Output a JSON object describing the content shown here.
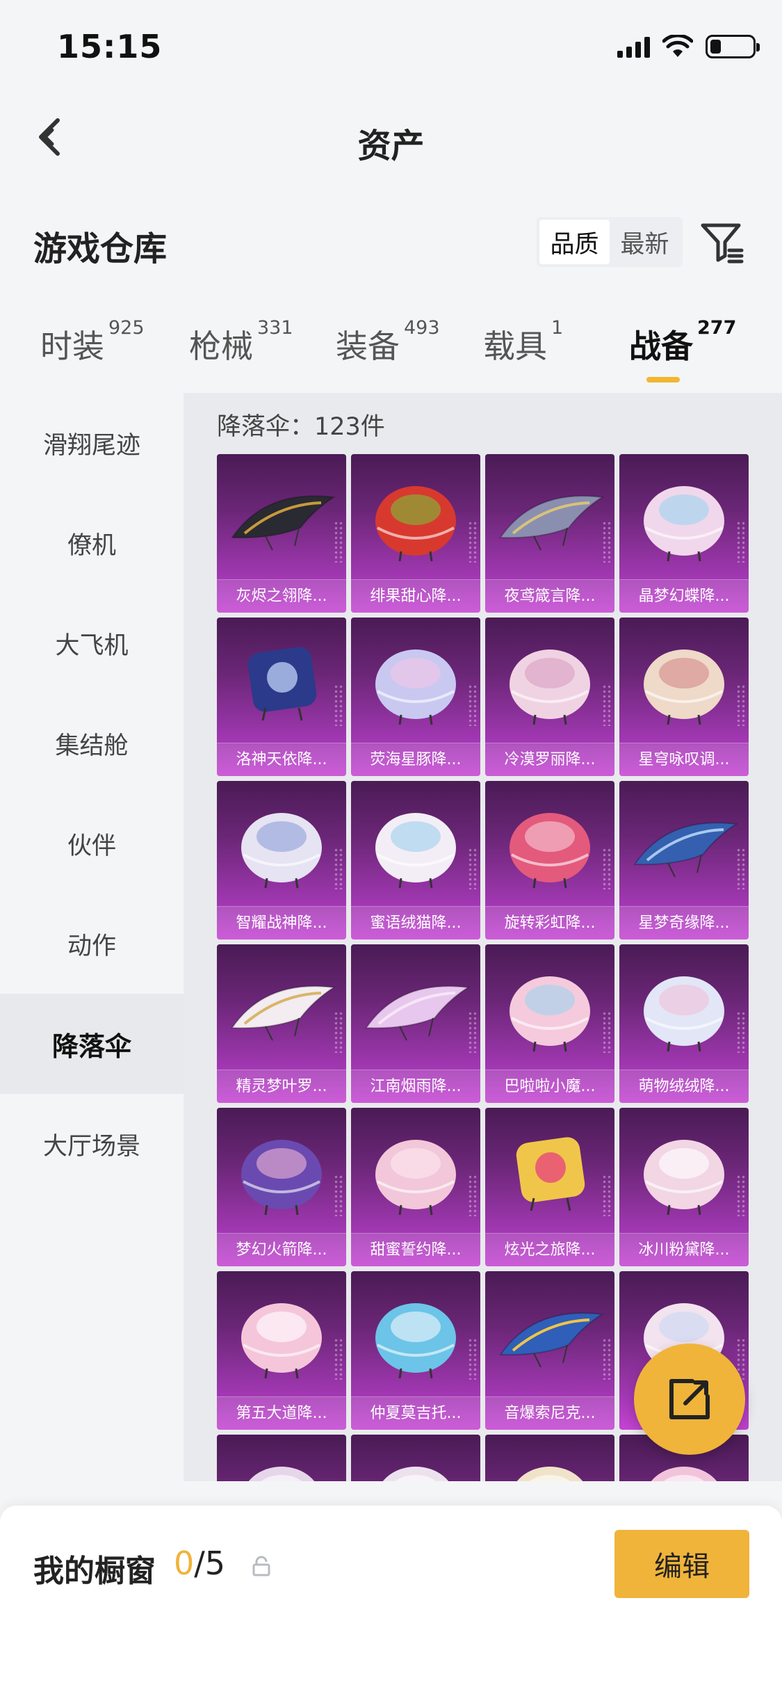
{
  "status_bar": {
    "time": "15:15",
    "battery_level_pct": 25
  },
  "nav": {
    "title": "资产"
  },
  "section": {
    "title": "游戏仓库",
    "sort_options": [
      "品质",
      "最新"
    ],
    "sort_selected": "品质"
  },
  "tabs": [
    {
      "label": "时装",
      "count": "925"
    },
    {
      "label": "枪械",
      "count": "331"
    },
    {
      "label": "装备",
      "count": "493"
    },
    {
      "label": "载具",
      "count": "1"
    },
    {
      "label": "战备",
      "count": "277",
      "active": true
    }
  ],
  "sidebar": {
    "items": [
      "滑翔尾迹",
      "僚机",
      "大飞机",
      "集结舱",
      "伙伴",
      "动作",
      "降落伞",
      "大厅场景"
    ],
    "active": "降落伞"
  },
  "content": {
    "count_label": "降落伞：123件",
    "items": [
      {
        "name": "灰烬之翎降...",
        "color": "#2a2a33",
        "accent": "#c89a3a",
        "shape": "wing"
      },
      {
        "name": "绯果甜心降...",
        "color": "#d8392f",
        "accent": "#7bbf3a",
        "shape": "round"
      },
      {
        "name": "夜鸢箴言降...",
        "color": "#8a8fb0",
        "accent": "#d8c27a",
        "shape": "wing"
      },
      {
        "name": "晶梦幻蝶降...",
        "color": "#f1d7ec",
        "accent": "#9bd6f0",
        "shape": "round"
      },
      {
        "name": "洛神天依降...",
        "color": "#2b3a8a",
        "accent": "#b7c9ef",
        "shape": "square"
      },
      {
        "name": "荧海星豚降...",
        "color": "#c9c8f1",
        "accent": "#f3c6e6",
        "shape": "round"
      },
      {
        "name": "冷漠罗丽降...",
        "color": "#f0d3e3",
        "accent": "#d9a0c3",
        "shape": "round"
      },
      {
        "name": "星穹咏叹调...",
        "color": "#efd9c8",
        "accent": "#d28a8a",
        "shape": "round"
      },
      {
        "name": "智耀战神降...",
        "color": "#e6e3f3",
        "accent": "#8fa0d9",
        "shape": "round"
      },
      {
        "name": "蜜语绒猫降...",
        "color": "#f3eef6",
        "accent": "#9fd0ee",
        "shape": "round"
      },
      {
        "name": "旋转彩虹降...",
        "color": "#e35a7d",
        "accent": "#f6c9d5",
        "shape": "round"
      },
      {
        "name": "星梦奇缘降...",
        "color": "#3560b0",
        "accent": "#a9c9ef",
        "shape": "wing"
      },
      {
        "name": "精灵梦叶罗...",
        "color": "#f3ecf0",
        "accent": "#d7b56a",
        "shape": "wing"
      },
      {
        "name": "江南烟雨降...",
        "color": "#e8c7ee",
        "accent": "#f7e6f7",
        "shape": "wing"
      },
      {
        "name": "巴啦啦小魔...",
        "color": "#f5cadd",
        "accent": "#9fd3ef",
        "shape": "round"
      },
      {
        "name": "萌物绒绒降...",
        "color": "#e2e6f7",
        "accent": "#f1c0d8",
        "shape": "round"
      },
      {
        "name": "梦幻火箭降...",
        "color": "#6a4ab0",
        "accent": "#f0b6d6",
        "shape": "round"
      },
      {
        "name": "甜蜜誓约降...",
        "color": "#f2c7d9",
        "accent": "#fbe7ef",
        "shape": "round"
      },
      {
        "name": "炫光之旅降...",
        "color": "#f0c64a",
        "accent": "#e8487a",
        "shape": "square"
      },
      {
        "name": "冰川粉黛降...",
        "color": "#f2d6e4",
        "accent": "#ffffff",
        "shape": "round"
      },
      {
        "name": "第五大道降...",
        "color": "#f5c6d9",
        "accent": "#ffffff",
        "shape": "round"
      },
      {
        "name": "仲夏莫吉托...",
        "color": "#6cc4e8",
        "accent": "#f2f7fb",
        "shape": "round"
      },
      {
        "name": "音爆索尼克...",
        "color": "#2f5fb8",
        "accent": "#f0c34a",
        "shape": "wing"
      },
      {
        "name": "",
        "color": "#f3e3ef",
        "accent": "#c9d9f3",
        "shape": "round"
      },
      {
        "name": "",
        "color": "#e6d6ea",
        "accent": "#ffffff",
        "shape": "round"
      },
      {
        "name": "",
        "color": "#ece2ee",
        "accent": "#ffffff",
        "shape": "round"
      },
      {
        "name": "",
        "color": "#f0e3c9",
        "accent": "#ffffff",
        "shape": "round"
      },
      {
        "name": "",
        "color": "#f2c4dc",
        "accent": "#ffffff",
        "shape": "round"
      }
    ]
  },
  "bottom_bar": {
    "label": "我的橱窗",
    "current": "0",
    "total": "/5",
    "edit_label": "编辑"
  },
  "colors": {
    "accent": "#f0b43a",
    "card_top": "#4a1b55",
    "card_bottom": "#c443d2"
  },
  "icons": [
    "back-chevron-icon",
    "filter-icon",
    "share-external-icon",
    "lock-icon",
    "wifi-icon",
    "signal-icon",
    "battery-icon"
  ]
}
